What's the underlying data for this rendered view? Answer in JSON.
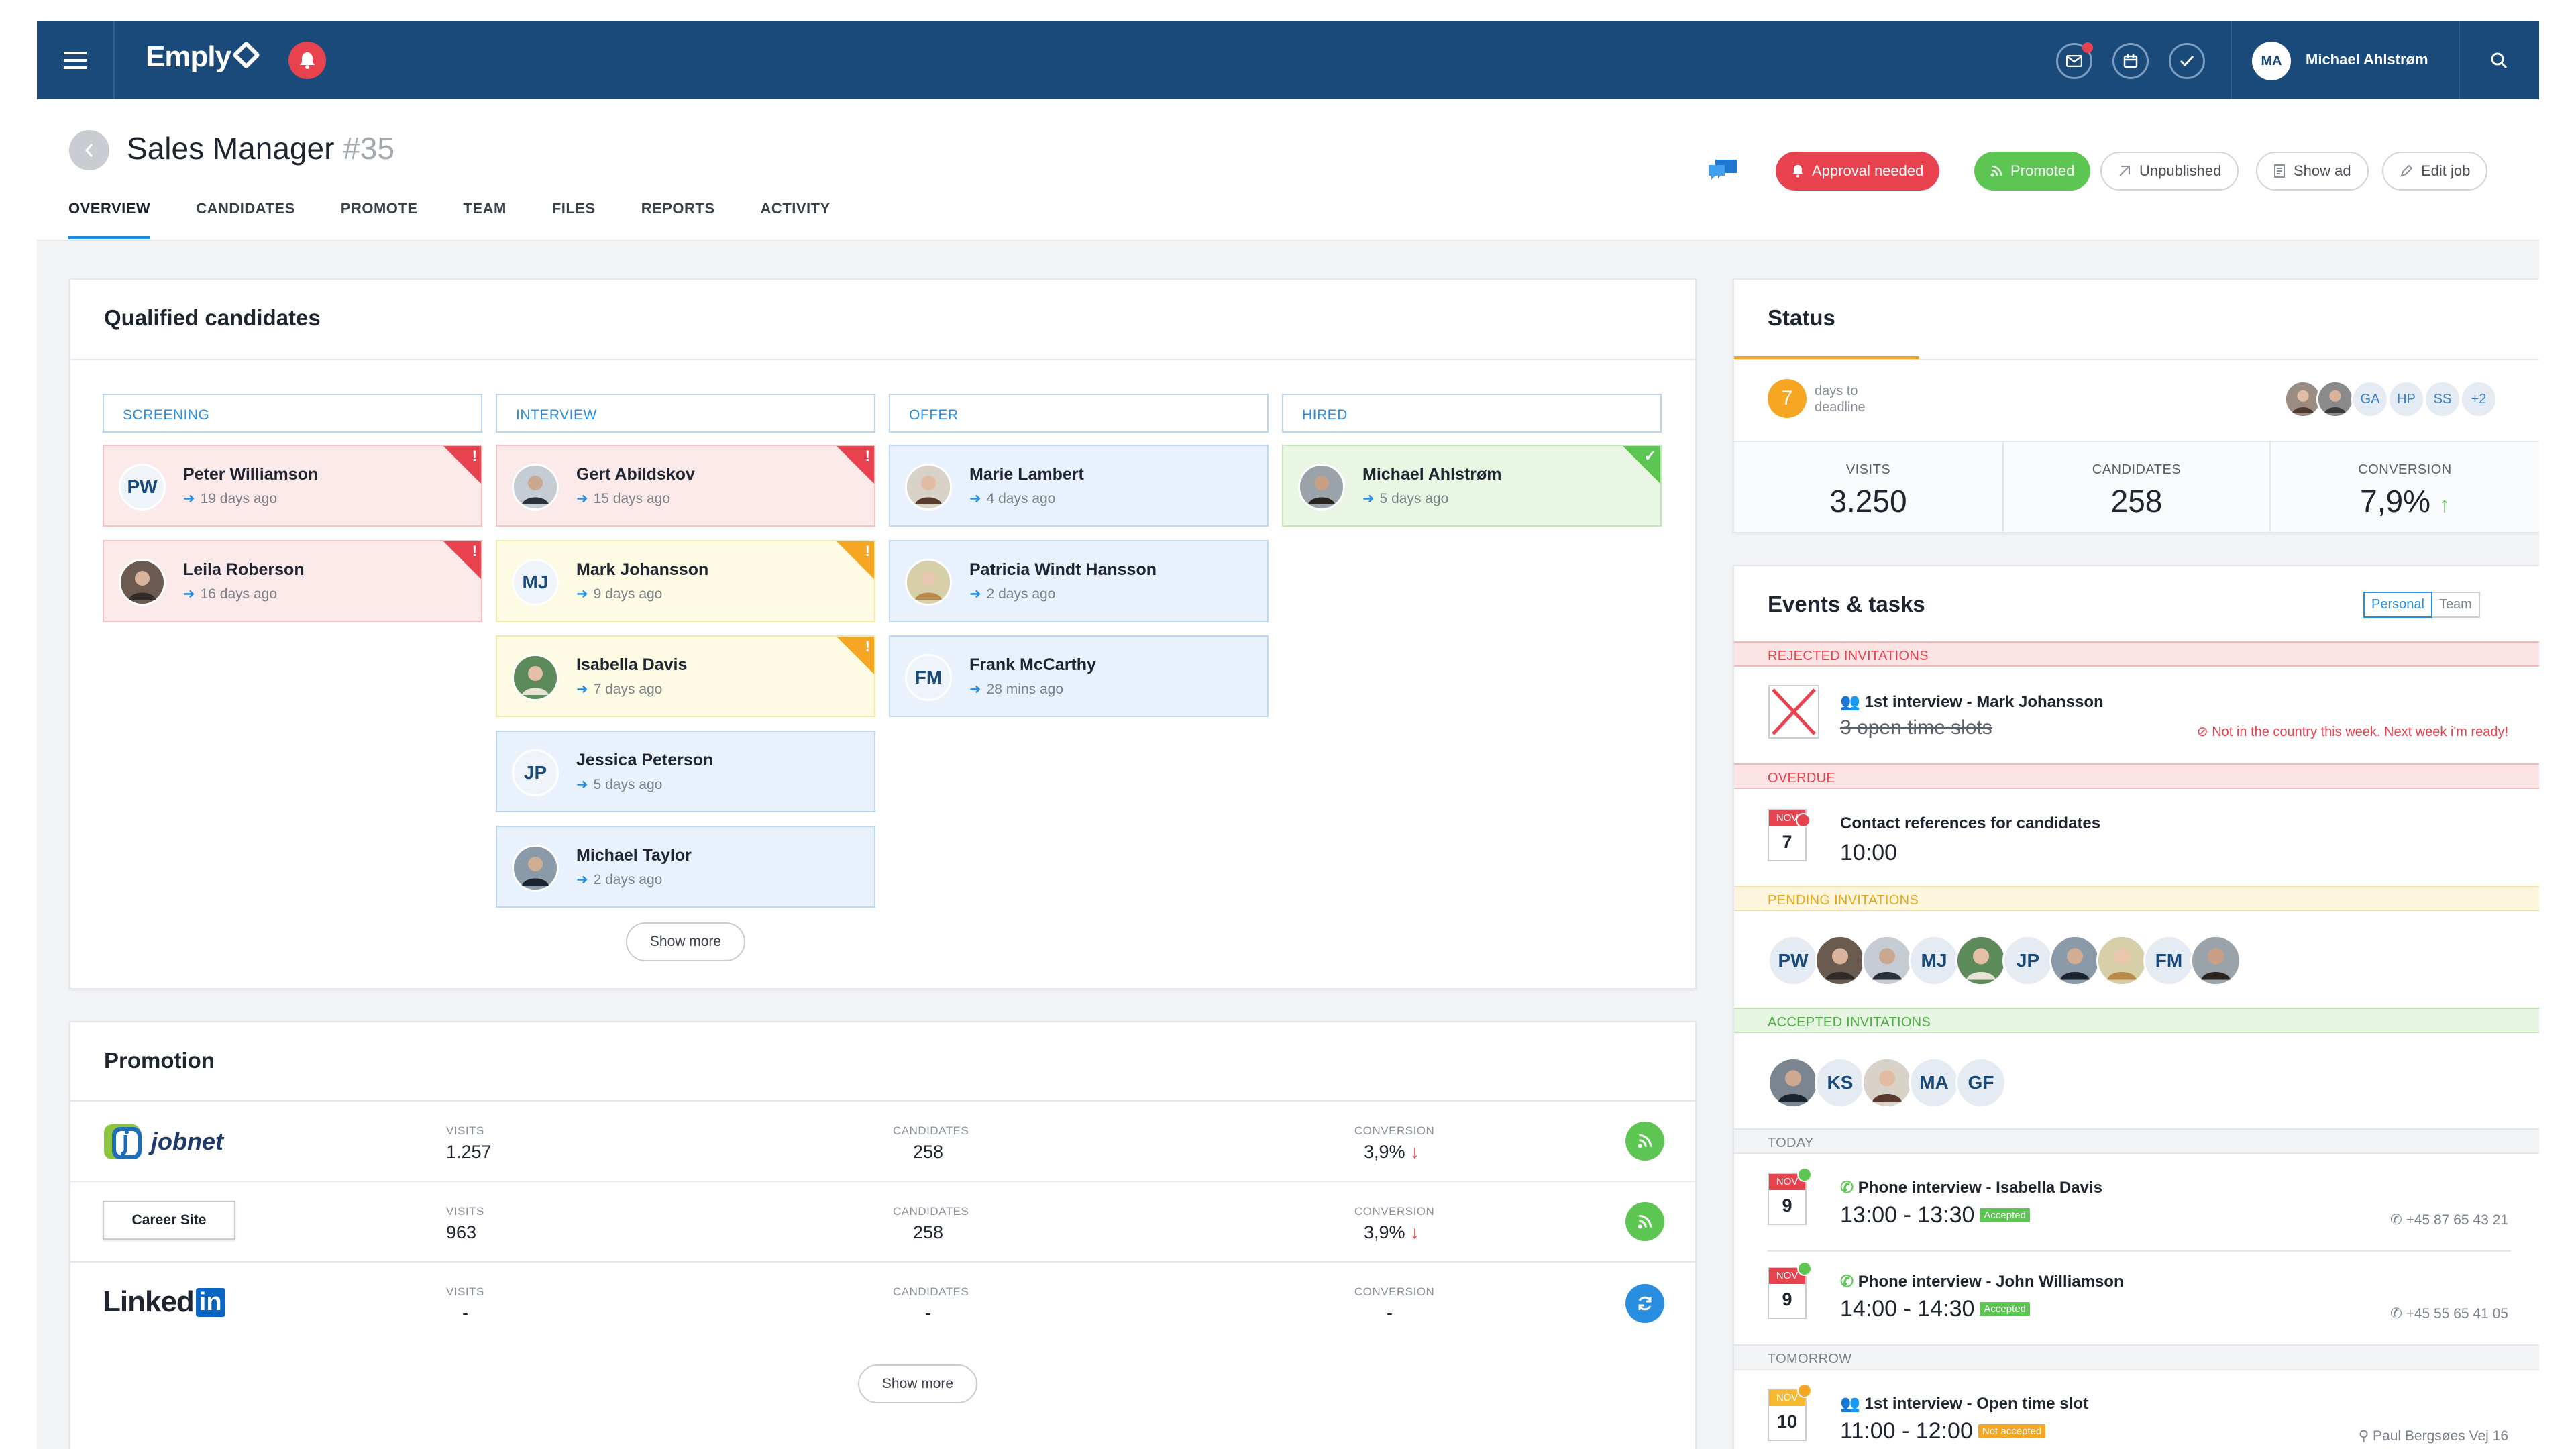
{
  "topbar": {
    "brand": "Emply",
    "user_initials": "MA",
    "user_name": "Michael Ahlstrøm"
  },
  "job": {
    "title": "Sales Manager",
    "number": "#35"
  },
  "tabs": [
    "OVERVIEW",
    "CANDIDATES",
    "PROMOTE",
    "TEAM",
    "FILES",
    "REPORTS",
    "ACTIVITY"
  ],
  "actions": {
    "approval": "Approval needed",
    "promoted": "Promoted",
    "unpublished": "Unpublished",
    "show_ad": "Show ad",
    "edit_job": "Edit job"
  },
  "qualified": {
    "title": "Qualified candidates",
    "columns": [
      {
        "label": "SCREENING",
        "cards": [
          {
            "initials": "PW",
            "name": "Peter Williamson",
            "time": "19 days ago",
            "tone": "red"
          },
          {
            "initials": "",
            "name": "Leila Roberson",
            "time": "16 days ago",
            "tone": "red"
          }
        ]
      },
      {
        "label": "INTERVIEW",
        "cards": [
          {
            "initials": "",
            "name": "Gert Abildskov",
            "time": "15 days ago",
            "tone": "red"
          },
          {
            "initials": "MJ",
            "name": "Mark Johansson",
            "time": "9 days ago",
            "tone": "yellow"
          },
          {
            "initials": "",
            "name": "Isabella Davis",
            "time": "7 days ago",
            "tone": "yellow"
          },
          {
            "initials": "JP",
            "name": "Jessica Peterson",
            "time": "5 days ago",
            "tone": "blue"
          },
          {
            "initials": "",
            "name": "Michael Taylor",
            "time": "2 days ago",
            "tone": "blue"
          }
        ]
      },
      {
        "label": "OFFER",
        "cards": [
          {
            "initials": "",
            "name": "Marie Lambert",
            "time": "4 days ago",
            "tone": "blue"
          },
          {
            "initials": "",
            "name": "Patricia Windt Hansson",
            "time": "2 days ago",
            "tone": "blue"
          },
          {
            "initials": "FM",
            "name": "Frank McCarthy",
            "time": "28 mins ago",
            "tone": "blue"
          }
        ]
      },
      {
        "label": "HIRED",
        "cards": [
          {
            "initials": "",
            "name": "Michael Ahlstrøm",
            "time": "5 days ago",
            "tone": "green"
          }
        ]
      }
    ],
    "show_more": "Show more"
  },
  "promotion": {
    "title": "Promotion",
    "label_visits": "VISITS",
    "label_candidates": "CANDIDATES",
    "label_conversion": "CONVERSION",
    "rows": [
      {
        "source": "jobnet",
        "visits": "1.257",
        "candidates": "258",
        "conversion": "3,9%",
        "status": "rss-green"
      },
      {
        "source": "Career Site",
        "visits": "963",
        "candidates": "258",
        "conversion": "3,9%",
        "status": "rss-green"
      },
      {
        "source": "Linked",
        "source_suffix": "in",
        "visits": "-",
        "candidates": "-",
        "conversion": "-",
        "status": "refresh-blue"
      }
    ],
    "show_more": "Show more"
  },
  "status": {
    "title": "Status",
    "days": "7",
    "days_label_1": "days to",
    "days_label_2": "deadline",
    "team": [
      "GA",
      "HP",
      "SS",
      "+2"
    ],
    "visits_label": "VISITS",
    "visits": "3.250",
    "candidates_label": "CANDIDATES",
    "candidates": "258",
    "conversion_label": "CONVERSION",
    "conversion": "7,9%"
  },
  "events": {
    "title": "Events & tasks",
    "toggle_personal": "Personal",
    "toggle_team": "Team",
    "rejected_label": "REJECTED INVITATIONS",
    "rejected_title": "1st interview - Mark Johansson",
    "rejected_sub": "3 open time slots",
    "rejected_note": "Not in the country this week. Next week i'm ready!",
    "overdue_label": "OVERDUE",
    "overdue_month": "NOV",
    "overdue_day": "7",
    "overdue_title": "Contact references for candidates",
    "overdue_time": "10:00",
    "pending_label": "PENDING INVITATIONS",
    "pending": [
      "PW",
      "",
      "",
      "MJ",
      "",
      "JP",
      "",
      "",
      "FM",
      ""
    ],
    "accepted_label": "ACCEPTED INVITATIONS",
    "accepted": [
      "",
      "KS",
      "",
      "MA",
      "GF"
    ],
    "today_label": "TODAY",
    "today": [
      {
        "month": "NOV",
        "day": "9",
        "title": "Phone interview - Isabella Davis",
        "time": "13:00 - 13:30",
        "tag": "Accepted",
        "right": "+45 87 65 43 21"
      },
      {
        "month": "NOV",
        "day": "9",
        "title": "Phone interview - John Williamson",
        "time": "14:00 - 14:30",
        "tag": "Accepted",
        "right": "+45 55 65 41 05"
      }
    ],
    "tomorrow_label": "TOMORROW",
    "tomorrow": [
      {
        "month": "NOV",
        "day": "10",
        "title": "1st interview - Open time slot",
        "time": "11:00 - 12:00",
        "tag": "Not accepted",
        "right": "Paul Bergsøes Vej 16"
      }
    ]
  },
  "colors": {
    "topbar": "#1a4a7a",
    "accent": "#2a8ee0",
    "red": "#e8424f",
    "green": "#5dc552",
    "orange": "#f5a623"
  }
}
